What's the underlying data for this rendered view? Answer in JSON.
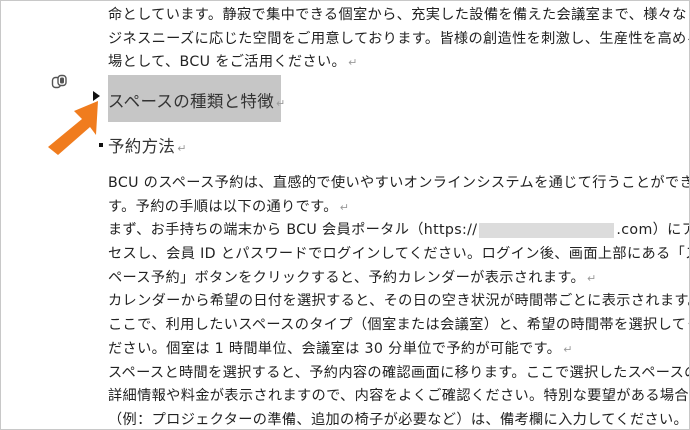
{
  "document": {
    "intro_lines": [
      "命としています。静寂で集中できる個室から、充実した設備を備えた会議室まで、様々なビ",
      "ジネスニーズに応じた空間をご用意しております。皆様の創造性を刺激し、生産性を高める",
      "場として、BCU をご活用ください。"
    ],
    "heading_selected": "スペースの種類と特徴",
    "heading_reservation": "予約方法",
    "body_lines": [
      "BCU のスペース予約は、直感的で使いやすいオンラインシステムを通じて行うことができま",
      "す。予約の手順は以下の通りです。",
      "まず、お手持ちの端末から BCU 会員ポータル（https://",
      ".com）にアク",
      "セスし、会員 ID とパスワードでログインしてください。ログイン後、画面上部にある「ス",
      "ペース予約」ボタンをクリックすると、予約カレンダーが表示されます。",
      "カレンダーから希望の日付を選択すると、その日の空き状況が時間帯ごとに表示されます。",
      "ここで、利用したいスペースのタイプ（個室または会議室）と、希望の時間帯を選択してく",
      "ださい。個室は 1 時間単位、会議室は 30 分単位で予約が可能です。",
      "スペースと時間を選択すると、予約内容の確認画面に移ります。ここで選択したスペースの",
      "詳細情報や料金が表示されますので、内容をよくご確認ください。特別な要望がある場合",
      "（例：プロジェクターの準備、追加の椅子が必要など）は、備考欄に入力してください。"
    ],
    "paragraph_mark": "↵",
    "colors": {
      "arrow": "#f07c1e",
      "selection": "#c6c6c6"
    },
    "icons": [
      "drag-handle-icon",
      "collapse-triangle-icon",
      "orange-arrow-icon"
    ]
  }
}
